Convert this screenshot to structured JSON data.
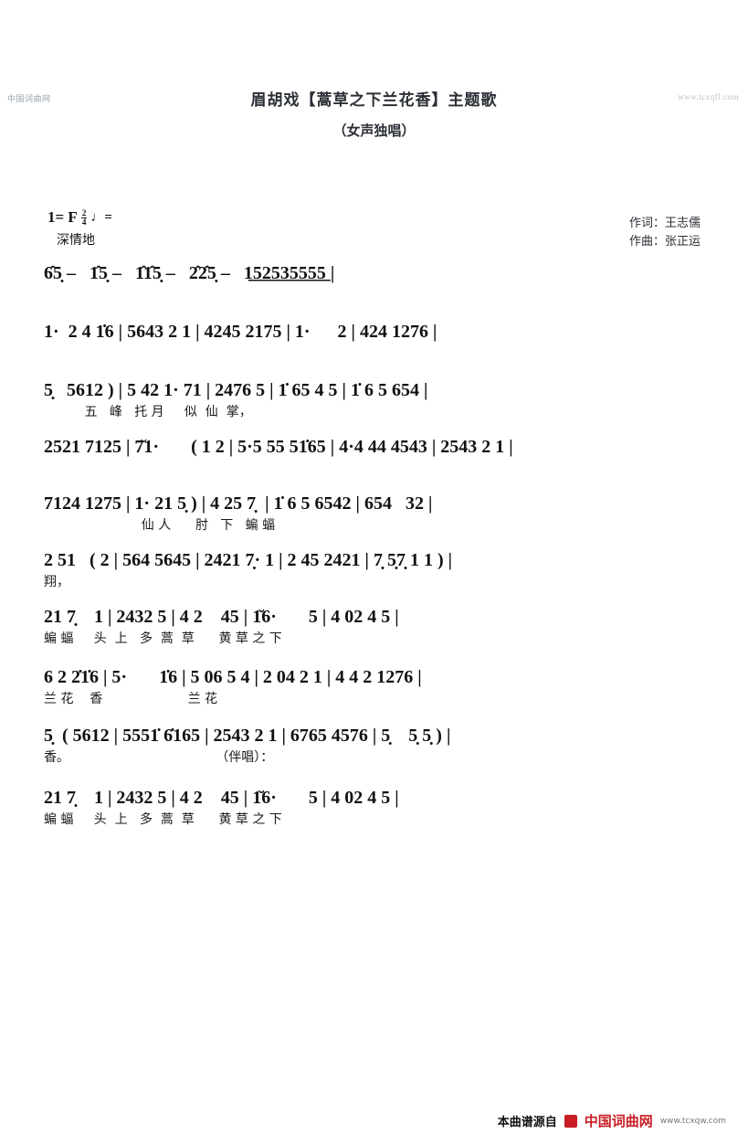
{
  "watermarks": {
    "left": "中国词曲网",
    "right": "www.tcxqfl.com"
  },
  "header": {
    "title": "眉胡戏【蒿草之下兰花香】主题歌",
    "subtitle": "（女声独唱）",
    "lyricist": "作词：王志儒",
    "composer": "作曲：张正运"
  },
  "key_signature": {
    "key": "1= F",
    "time_num": "2",
    "time_den": "4",
    "quarter_note": "♩=",
    "tempo_marking": "深情地"
  },
  "score": {
    "lines": [
      {
        "id": "line-1",
        "notes": "6̂5̣ –   1̂5̣ –   1̂1̂5̣ –   2̂2̂5̣ –   1̲5̲2̲5̲3̲5̲5̲5̲5̲ |",
        "notes_plain": "6 5 - 1 5 - 11 5 - 22 5 - 1 5 2 5 3 5 5 5 5 |",
        "lyrics": ""
      },
      {
        "id": "line-2",
        "notes": "1·  2 4 1̇6 | 5643 2 1 | 4245 2175 | 1·      2 | 424 1276 |",
        "lyrics": ""
      },
      {
        "id": "line-3",
        "notes": "5̣   5612 ) | 5 42 1· 71 | 2476 5 | 1̇ 65 4 5 | 1̇ 6 5 654 |",
        "lyrics": "          五   峰   托 月     似  仙  掌，"
      },
      {
        "id": "line-4",
        "notes": "2521 7125 | 7̆1·       ( 1 2 | 5·5 55 51̇65 | 4·4 44 4543 | 2543 2 1 |",
        "lyrics": ""
      },
      {
        "id": "line-5",
        "notes": "7124 1275 | 1· 21 5̣ ) | 4 25 7̣  | 1̇ 6 5 6542 | 654   32 |",
        "lyrics": "                        仙 人      肘   下   蝙 蝠"
      },
      {
        "id": "line-6",
        "notes": "2 51   ( 2 | 564 5645 | 2421 7̣· 1 | 2 45 2421 | 7̣ 5̣7̣ 1 1 ) |",
        "lyrics": "翔，"
      },
      {
        "id": "line-7",
        "notes": "21 7̣    1 | 2432 5 | 4 2    45 | 1̆6·       5 | 4 02 4 5 |",
        "lyrics": "蝙 蝠     头  上   多  蒿  草      黄 草 之 下"
      },
      {
        "id": "line-8",
        "notes": "6 2 2̇1̇6 | 5·       1̇6 | 5 06 5 4 | 2 04 2 1 | 4 4 2 1276 |",
        "lyrics": "兰 花    香                     兰 花"
      },
      {
        "id": "line-9",
        "notes": "5̣  ( 5612 | 5551̇ 6̇165 | 2543 2 1 | 6765 4576 | 5̣    5̣ 5̣ ) |",
        "lyrics": "香。                                    （伴唱）："
      },
      {
        "id": "line-10",
        "notes": "21 7̣    1 | 2432 5 | 4 2    45 | 1̆6·       5 | 4 02 4 5 |",
        "lyrics": "蝙 蝠     头  上   多  蒿  草      黄 草 之 下"
      }
    ]
  },
  "footer": {
    "source_label": "本曲谱源自",
    "brand": "中国词曲网",
    "site": "www.tcxqw.com"
  }
}
